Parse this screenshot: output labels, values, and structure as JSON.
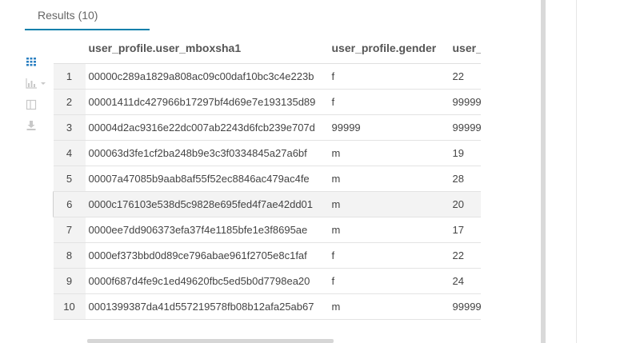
{
  "tabs": {
    "results_label": "Results (10)"
  },
  "toolbar": {
    "icons": [
      "grid-icon",
      "chart-icon",
      "columns-icon",
      "download-icon"
    ]
  },
  "colors": {
    "accent": "#0b7fab",
    "icon_active": "#2a7fc1",
    "icon_inactive": "#c8c8c8"
  },
  "table": {
    "headers": [
      "",
      "user_profile.user_mboxsha1",
      "user_profile.gender",
      "user_p"
    ],
    "rows": [
      {
        "num": "1",
        "sha": "00000c289a1829a808ac09c00daf10bc3c4e223b",
        "gender": "f",
        "age": "22"
      },
      {
        "num": "2",
        "sha": "00001411dc427966b17297bf4d69e7e193135d89",
        "gender": "f",
        "age": "99999"
      },
      {
        "num": "3",
        "sha": "00004d2ac9316e22dc007ab2243d6fcb239e707d",
        "gender": "99999",
        "age": "99999"
      },
      {
        "num": "4",
        "sha": "000063d3fe1cf2ba248b9e3c3f0334845a27a6bf",
        "gender": "m",
        "age": "19"
      },
      {
        "num": "5",
        "sha": "00007a47085b9aab8af55f52ec8846ac479ac4fe",
        "gender": "m",
        "age": "28"
      },
      {
        "num": "6",
        "sha": "0000c176103e538d5c9828e695fed4f7ae42dd01",
        "gender": "m",
        "age": "20"
      },
      {
        "num": "7",
        "sha": "0000ee7dd906373efa37f4e1185bfe1e3f8695ae",
        "gender": "m",
        "age": "17"
      },
      {
        "num": "8",
        "sha": "0000ef373bbd0d89ce796abae961f2705e8c1faf",
        "gender": "f",
        "age": "22"
      },
      {
        "num": "9",
        "sha": "0000f687d4fe9c1ed49620fbc5ed5b0d7798ea20",
        "gender": "f",
        "age": "24"
      },
      {
        "num": "10",
        "sha": "0001399387da41d557219578fb08b12afa25ab67",
        "gender": "m",
        "age": "99999"
      }
    ]
  }
}
